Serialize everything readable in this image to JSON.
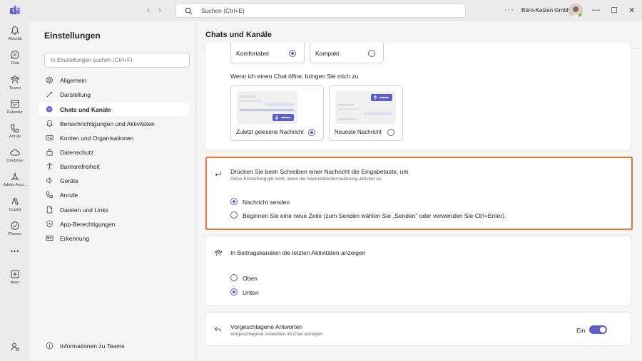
{
  "titlebar": {
    "search_placeholder": "Suchen (Ctrl+E)",
    "more_label": "···",
    "org_name": "Büro-Kaizen GmbH",
    "minimize": "—",
    "maximize": "☐",
    "close": "✕"
  },
  "rail": {
    "items": [
      {
        "label": "Aktivität",
        "icon": "bell-icon"
      },
      {
        "label": "Chat",
        "icon": "chat-icon"
      },
      {
        "label": "Teams",
        "icon": "teams-icon"
      },
      {
        "label": "Kalender",
        "icon": "calendar-icon"
      },
      {
        "label": "Anrufe",
        "icon": "phone-icon"
      },
      {
        "label": "OneDrive",
        "icon": "cloud-icon"
      },
      {
        "label": "Adobe Acro...",
        "icon": "adobe-icon"
      },
      {
        "label": "Copilot",
        "icon": "copilot-icon"
      },
      {
        "label": "Planner",
        "icon": "planner-icon"
      },
      {
        "label": "Apps",
        "icon": "apps-icon"
      }
    ],
    "more": "•••"
  },
  "sidebar": {
    "title": "Einstellungen",
    "search_placeholder": "In Einstellungen suchen (Ctrl+F)",
    "items": [
      {
        "label": "Allgemein",
        "icon": "gear-icon"
      },
      {
        "label": "Darstellung",
        "icon": "wand-icon"
      },
      {
        "label": "Chats und Kanäle",
        "icon": "chat-bubble-icon",
        "active": true
      },
      {
        "label": "Benachrichtigungen und Aktivitäten",
        "icon": "bell-icon"
      },
      {
        "label": "Konten und Organisationen",
        "icon": "id-card-icon"
      },
      {
        "label": "Datenschutz",
        "icon": "lock-icon"
      },
      {
        "label": "Barrierefreiheit",
        "icon": "accessibility-icon"
      },
      {
        "label": "Geräte",
        "icon": "speaker-icon"
      },
      {
        "label": "Anrufe",
        "icon": "phone-icon"
      },
      {
        "label": "Dateien und Links",
        "icon": "file-icon"
      },
      {
        "label": "App-Berechtigungen",
        "icon": "shield-icon"
      },
      {
        "label": "Erkennung",
        "icon": "card-icon"
      }
    ],
    "footer": "Informationen zu Teams"
  },
  "main": {
    "title": "Chats und Kanäle",
    "density": {
      "comfortable": "Komfortabel",
      "compact": "Kompakt",
      "selected": "Komfortabel"
    },
    "open_chat": {
      "heading": "Wenn ich einen Chat öffne, bringen Sie mich zu",
      "last_read": "Zuletzt gelesene Nachricht",
      "newest": "Neueste Nachricht",
      "selected": "Zuletzt gelesene Nachricht"
    },
    "enter_key": {
      "title": "Drücken Sie beim Schreiben einer Nachricht die Eingabetaste, um",
      "subtitle": "Diese Einstellung gilt nicht, wenn die Nachrichtenformatierung aktiviert ist.",
      "opt_send": "Nachricht senden",
      "opt_newline": "Beginnen Sie eine neue Zeile (zum Senden wählen Sie „Senden“ oder verwenden Sie Ctrl+Enter).",
      "selected": "Nachricht senden"
    },
    "channel_activity": {
      "title": "In Beitragskanälen die letzten Aktivitäten anzeigen",
      "opt_top": "Oben",
      "opt_bottom": "Unten",
      "selected": "Unten"
    },
    "suggested_replies": {
      "title": "Vorgeschlagene Antworten",
      "subtitle": "Vorgeschlagene Antworten im Chat anzeigen",
      "toggle_label": "Ein",
      "enabled": true
    }
  },
  "colors": {
    "accent": "#5b5fc7",
    "highlight_border": "#e6743a",
    "presence": "#6bb700"
  }
}
